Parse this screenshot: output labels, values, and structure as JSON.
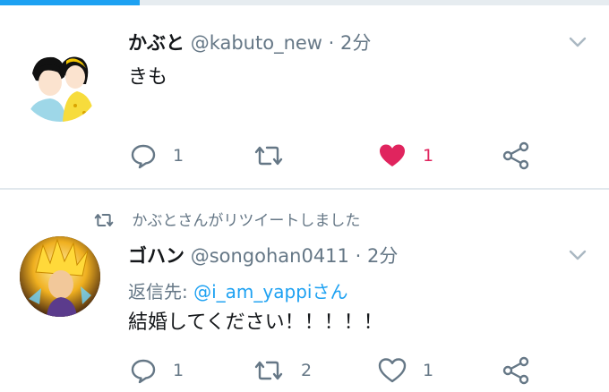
{
  "progress": {
    "fraction": 0.23,
    "color": "#1da1f2"
  },
  "tweets": [
    {
      "name": "かぶと",
      "handle": "@kabuto_new",
      "dot": "·",
      "time": "2分",
      "text": "きも",
      "avatar_icon": "anime-couple-avatar",
      "actions": {
        "reply_count": "1",
        "retweet_count": "",
        "like_count": "1",
        "liked": true
      },
      "icons": {
        "reply": "reply-icon",
        "retweet": "retweet-icon",
        "like": "heart-filled-icon",
        "share": "share-icon",
        "menu": "chevron-down-icon"
      }
    },
    {
      "retweet_notice": "かぶとさんがリツイートしました",
      "name": "ゴハン",
      "handle": "@songohan0411",
      "dot": "·",
      "time": "2分",
      "reply_label": "返信先: ",
      "reply_mention": "@i_am_yappiさん",
      "text": "結婚してください！！！！！",
      "avatar_icon": "super-saiyan-avatar",
      "actions": {
        "reply_count": "1",
        "retweet_count": "2",
        "like_count": "1",
        "liked": false
      },
      "icons": {
        "reply": "reply-icon",
        "retweet": "retweet-icon",
        "like": "heart-outline-icon",
        "share": "share-icon",
        "menu": "chevron-down-icon"
      }
    }
  ],
  "colors": {
    "accent": "#1da1f2",
    "like": "#e0245e",
    "muted": "#657786",
    "text": "#14171a",
    "divider": "#e1e8ed"
  }
}
